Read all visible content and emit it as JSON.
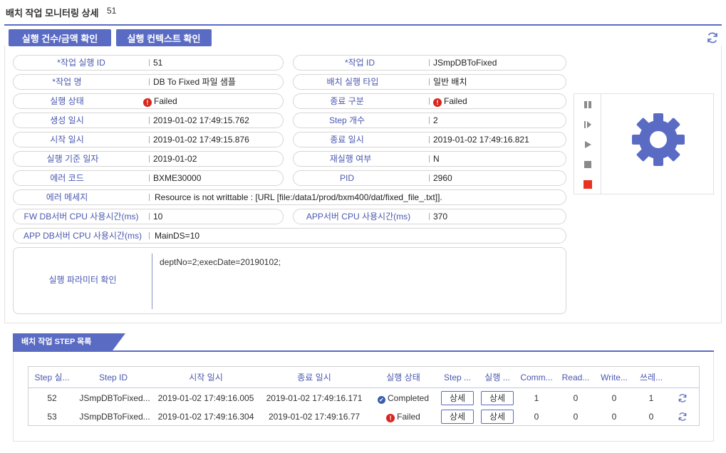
{
  "page": {
    "title": "배치 작업 모니터링 상세",
    "id": "51"
  },
  "toolbar": {
    "amount_label": "실행 건수/금액 확인",
    "context_label": "실행 컨텍스트 확인"
  },
  "required_mark": "*",
  "fields": {
    "exec_id": {
      "label": "작업 실행 ID",
      "value": "51"
    },
    "job_id": {
      "label": "작업 ID",
      "value": "JSmpDBToFixed"
    },
    "job_name": {
      "label": "작업 명",
      "value": "DB To Fixed 파일 샘플"
    },
    "exec_type": {
      "label": "배치 실행 타입",
      "value": "일반 배치"
    },
    "exec_status": {
      "label": "실행 상태",
      "value": "Failed"
    },
    "end_type": {
      "label": "종료 구분",
      "value": "Failed"
    },
    "created_at": {
      "label": "생성 일시",
      "value": "2019-01-02 17:49:15.762"
    },
    "step_count": {
      "label": "Step 개수",
      "value": "2"
    },
    "start_at": {
      "label": "시작 일시",
      "value": "2019-01-02 17:49:15.876"
    },
    "end_at": {
      "label": "종료 일시",
      "value": "2019-01-02 17:49:16.821"
    },
    "base_date": {
      "label": "실행 기준 일자",
      "value": "2019-01-02"
    },
    "rerun": {
      "label": "재실행 여부",
      "value": "N"
    },
    "error_code": {
      "label": "에러 코드",
      "value": "BXME30000"
    },
    "pid": {
      "label": "PID",
      "value": "2960"
    },
    "error_msg": {
      "label": "에러 메세지",
      "value": "Resource is not writtable : [URL [file:/data1/prod/bxm400/dat/fixed_file_.txt]]."
    },
    "fw_db_cpu": {
      "label": "FW DB서버 CPU 사용시간(ms)",
      "value": "10"
    },
    "app_cpu": {
      "label": "APP서버 CPU 사용시간(ms)",
      "value": "370"
    },
    "app_db_cpu": {
      "label": "APP DB서버 CPU 사용시간(ms)",
      "value": "MainDS=10"
    }
  },
  "params": {
    "label": "실행 파라미터 확인",
    "value": "deptNo=2;execDate=20190102;"
  },
  "controls": {
    "icons": [
      "pause-icon",
      "step-forward-icon",
      "play-icon",
      "stop-icon",
      "force-stop-icon"
    ],
    "force_stop_color": "#e8321f",
    "gear_color": "#5a6bc4"
  },
  "tab": {
    "label": "배치 작업 STEP 목록"
  },
  "grid": {
    "headers": [
      "Step 실...",
      "Step ID",
      "시작 일시",
      "종료 일시",
      "실행 상태",
      "Step ...",
      "실행 ...",
      "Comm...",
      "Read...",
      "Write...",
      "쓰레..."
    ],
    "rows": [
      {
        "exec": "52",
        "step_id": "JSmpDBToFixed...",
        "start": "2019-01-02 17:49:16.005",
        "end": "2019-01-02 17:49:16.171",
        "status": "Completed",
        "status_kind": "ok",
        "step_btn": "상세",
        "exec_btn": "상세",
        "commit": "1",
        "read": "0",
        "write": "0",
        "thread": "1"
      },
      {
        "exec": "53",
        "step_id": "JSmpDBToFixed...",
        "start": "2019-01-02 17:49:16.304",
        "end": "2019-01-02 17:49:16.77",
        "status": "Failed",
        "status_kind": "error",
        "step_btn": "상세",
        "exec_btn": "상세",
        "commit": "0",
        "read": "0",
        "write": "0",
        "thread": "0"
      }
    ]
  },
  "colors": {
    "accent": "#5a6bc4",
    "label": "#4a58b0",
    "error": "#d7261e",
    "ok": "#3b5fb0"
  }
}
